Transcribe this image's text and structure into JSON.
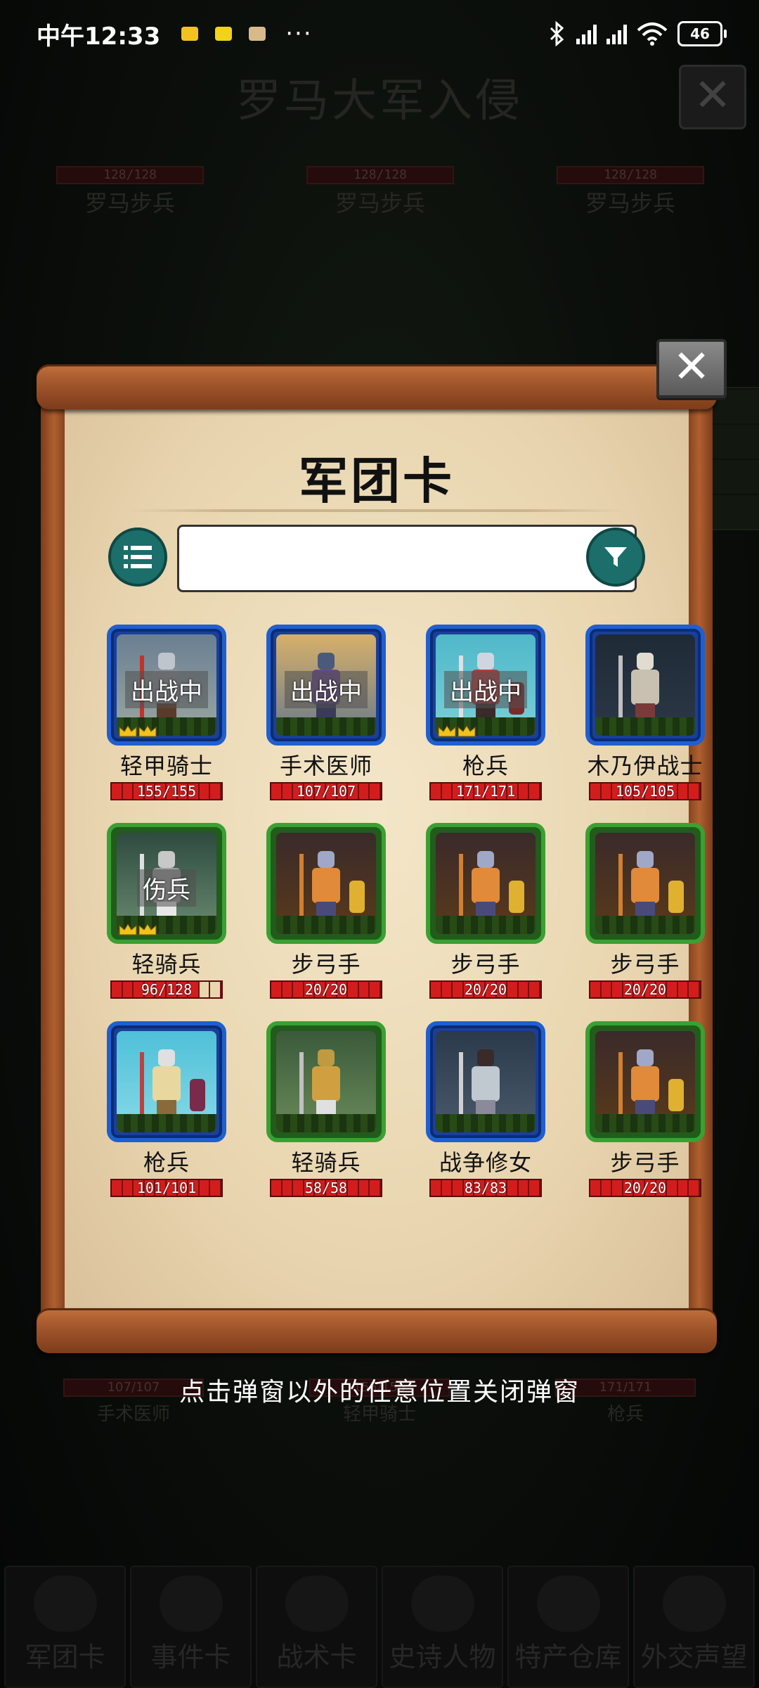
{
  "status_bar": {
    "time": "中午12:33",
    "more": "···",
    "battery": "46"
  },
  "background": {
    "title": "罗马大军入侵",
    "enemies": [
      {
        "hp": "128/128",
        "name": "罗马步兵"
      },
      {
        "hp": "128/128",
        "name": "罗马步兵"
      },
      {
        "hp": "128/128",
        "name": "罗马步兵"
      }
    ],
    "allies": [
      {
        "hp": "107/107",
        "name": "手术医师"
      },
      {
        "hp": "155/155",
        "name": "轻甲骑士"
      },
      {
        "hp": "171/171",
        "name": "枪兵"
      }
    ],
    "tabs": [
      "军团卡",
      "事件卡",
      "战术卡",
      "史诗人物",
      "特产仓库",
      "外交声望"
    ]
  },
  "panel": {
    "title": "军团卡",
    "search": {
      "value": "",
      "placeholder": ""
    },
    "cards": [
      {
        "name": "轻甲骑士",
        "hp": "155/155",
        "hp_fraction": 1.0,
        "tag": "出战中",
        "rarity": "blue",
        "crown": true
      },
      {
        "name": "手术医师",
        "hp": "107/107",
        "hp_fraction": 1.0,
        "tag": "出战中",
        "rarity": "blue",
        "crown": false
      },
      {
        "name": "枪兵",
        "hp": "171/171",
        "hp_fraction": 1.0,
        "tag": "出战中",
        "rarity": "blue",
        "crown": true
      },
      {
        "name": "木乃伊战士",
        "hp": "105/105",
        "hp_fraction": 1.0,
        "tag": "",
        "rarity": "blue",
        "crown": false
      },
      {
        "name": "轻骑兵",
        "hp": "96/128",
        "hp_fraction": 0.75,
        "tag": "伤兵",
        "rarity": "green",
        "crown": true
      },
      {
        "name": "步弓手",
        "hp": "20/20",
        "hp_fraction": 1.0,
        "tag": "",
        "rarity": "green",
        "crown": false
      },
      {
        "name": "步弓手",
        "hp": "20/20",
        "hp_fraction": 1.0,
        "tag": "",
        "rarity": "green",
        "crown": false
      },
      {
        "name": "步弓手",
        "hp": "20/20",
        "hp_fraction": 1.0,
        "tag": "",
        "rarity": "green",
        "crown": false
      },
      {
        "name": "枪兵",
        "hp": "101/101",
        "hp_fraction": 1.0,
        "tag": "",
        "rarity": "blue",
        "crown": false
      },
      {
        "name": "轻骑兵",
        "hp": "58/58",
        "hp_fraction": 1.0,
        "tag": "",
        "rarity": "green",
        "crown": false
      },
      {
        "name": "战争修女",
        "hp": "83/83",
        "hp_fraction": 1.0,
        "tag": "",
        "rarity": "blue",
        "crown": false
      },
      {
        "name": "步弓手",
        "hp": "20/20",
        "hp_fraction": 1.0,
        "tag": "",
        "rarity": "green",
        "crown": false
      }
    ]
  },
  "hint": "点击弹窗以外的任意位置关闭弹窗",
  "icons": {
    "close": "close-icon",
    "list": "list-icon",
    "filter": "filter-icon"
  }
}
